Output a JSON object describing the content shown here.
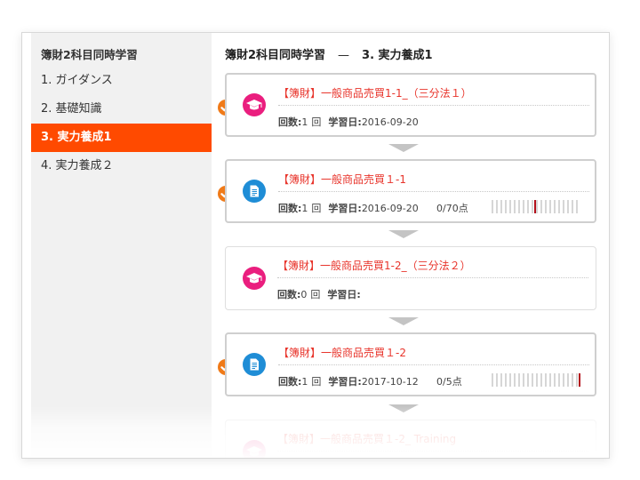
{
  "sidebar": {
    "title": "簿財2科目同時学習",
    "items": [
      {
        "label": "1. ガイダンス",
        "active": false
      },
      {
        "label": "2. 基礎知識",
        "active": false
      },
      {
        "label": "3. 実力養成1",
        "active": true
      },
      {
        "label": "4. 実力養成２",
        "active": false
      }
    ]
  },
  "main": {
    "title_course": "簿財2科目同時学習",
    "title_sep": "—",
    "title_section": "3. 実力養成1"
  },
  "labels": {
    "count_label": "回数:",
    "count_unit": "回",
    "date_label": "学習日:"
  },
  "cards": [
    {
      "icon": "graduation-cap-icon",
      "title": "【簿財】一般商品売買1-1_（三分法１）",
      "count": "1",
      "date": "2016-09-20",
      "score": "",
      "score_ratio": null,
      "completed": true
    },
    {
      "icon": "document-icon",
      "title": "【簿財】一般商品売買１-1",
      "count": "1",
      "date": "2016-09-20",
      "score": "0/70点",
      "score_ratio": 0.5,
      "completed": true
    },
    {
      "icon": "graduation-cap-icon",
      "title": "【簿財】一般商品売買1-2_（三分法２）",
      "count": "0",
      "date": "",
      "score": "",
      "score_ratio": null,
      "completed": false
    },
    {
      "icon": "document-icon",
      "title": "【簿財】一般商品売買１-2",
      "count": "1",
      "date": "2017-10-12",
      "score": "0/5点",
      "score_ratio": 1.0,
      "completed": true
    },
    {
      "icon": "graduation-cap-icon",
      "title": "【簿財】一般商品売買１-2_ Training",
      "count": "",
      "date": "",
      "score": "",
      "score_ratio": null,
      "completed": false
    }
  ],
  "colors": {
    "accent": "#ff4a00",
    "title_red": "#e8342b",
    "check_orange": "#f07a18",
    "icon_pink": "#ea1e7e",
    "icon_blue": "#1f8dd6"
  }
}
